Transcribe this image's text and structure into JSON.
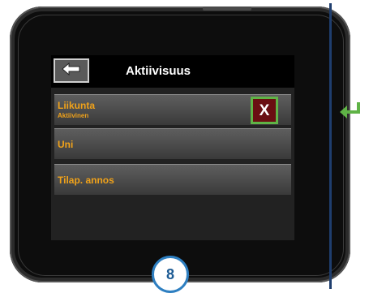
{
  "screen": {
    "title": "Aktiivisuus",
    "back_icon": "left-arrow-icon"
  },
  "menu": {
    "items": [
      {
        "label": "Liikunta",
        "sublabel": "Aktiivinen"
      },
      {
        "label": "Uni"
      },
      {
        "label": "Tilap. annos"
      }
    ],
    "cancel_label": "X"
  },
  "annotation": {
    "step": "8",
    "return_icon": "return-arrow-icon"
  },
  "colors": {
    "accent_orange": "#f0a21a",
    "highlight_green": "#5fb346",
    "cancel_red": "#6a0f12",
    "step_blue": "#2e7fc1"
  }
}
